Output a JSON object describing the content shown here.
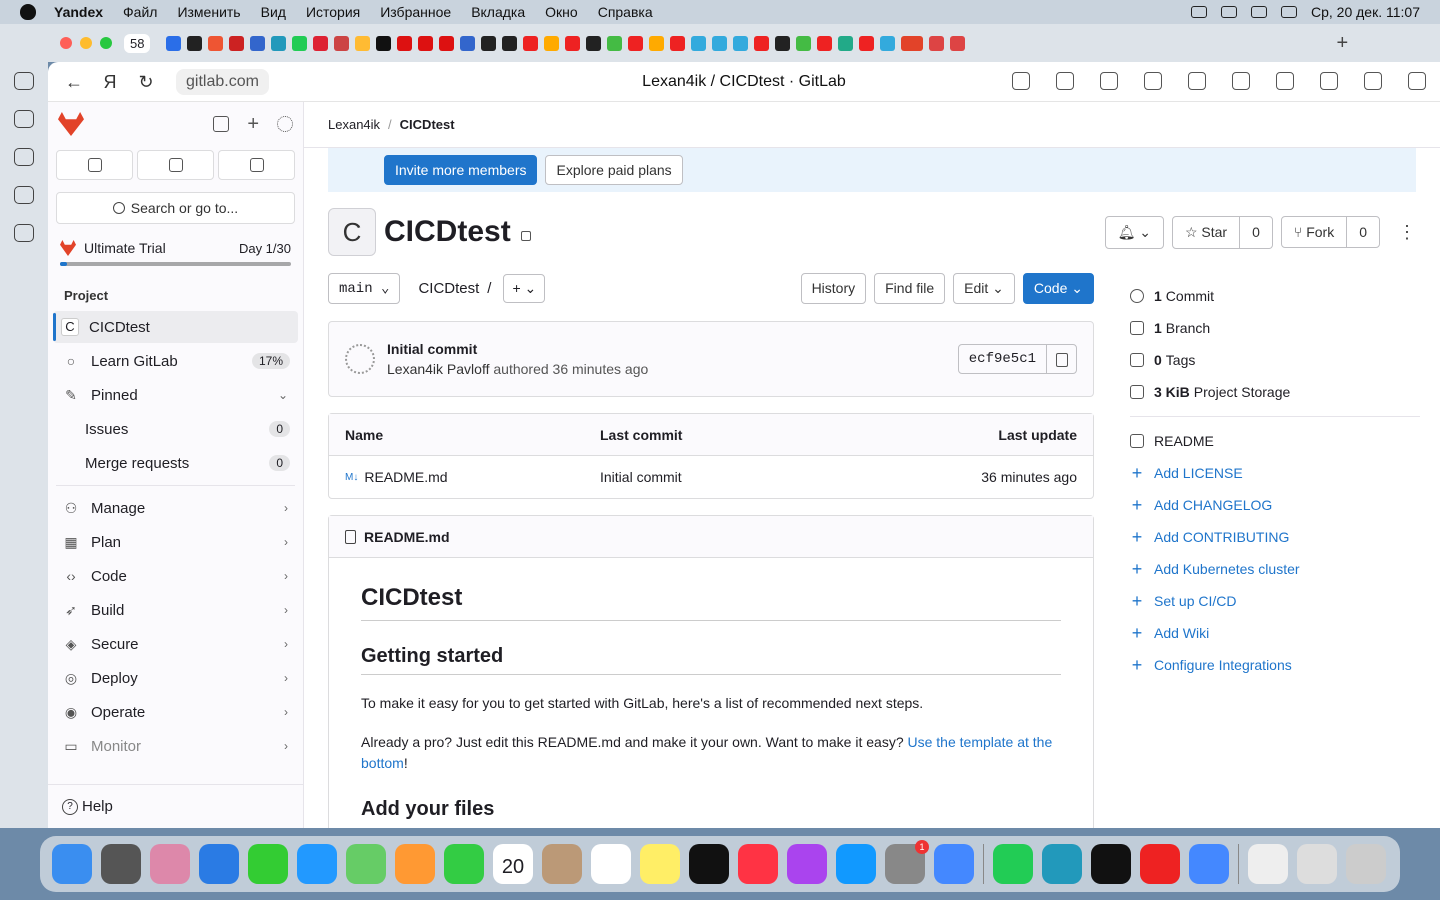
{
  "menubar": {
    "app": "Yandex",
    "items": [
      "Файл",
      "Изменить",
      "Вид",
      "История",
      "Избранное",
      "Вкладка",
      "Окно",
      "Справка"
    ],
    "clock": "Ср, 20 дек.  11:07"
  },
  "tabs": {
    "count": "58"
  },
  "address": {
    "url": "gitlab.com",
    "title": "Lexan4ik / CICDtest · GitLab"
  },
  "sidebar": {
    "search_label": "Search or go to...",
    "trial": {
      "label": "Ultimate Trial",
      "day": "Day 1/30",
      "progress": 0.03
    },
    "section": "Project",
    "items": [
      {
        "label": "CICDtest",
        "icon": "project-avatar",
        "active": true
      },
      {
        "label": "Learn GitLab",
        "icon": "bulb-icon",
        "badge": "17%"
      },
      {
        "label": "Pinned",
        "icon": "pin-icon",
        "expand": true
      }
    ],
    "pinned": [
      {
        "label": "Issues",
        "count": "0"
      },
      {
        "label": "Merge requests",
        "count": "0"
      }
    ],
    "groups": [
      {
        "label": "Manage",
        "icon": "users-icon"
      },
      {
        "label": "Plan",
        "icon": "calendar-icon"
      },
      {
        "label": "Code",
        "icon": "code-icon"
      },
      {
        "label": "Build",
        "icon": "rocket-icon"
      },
      {
        "label": "Secure",
        "icon": "shield-icon"
      },
      {
        "label": "Deploy",
        "icon": "deploy-icon"
      },
      {
        "label": "Operate",
        "icon": "operate-icon"
      },
      {
        "label": "Monitor",
        "icon": "monitor-icon"
      }
    ],
    "help": "Help"
  },
  "breadcrumb": {
    "owner": "Lexan4ik",
    "project": "CICDtest"
  },
  "banner": {
    "invite": "Invite more members",
    "explore": "Explore paid plans"
  },
  "project": {
    "initial": "C",
    "name": "CICDtest",
    "star": "Star",
    "star_count": "0",
    "fork": "Fork",
    "fork_count": "0"
  },
  "tree": {
    "branch": "main",
    "path": "CICDtest",
    "history": "History",
    "find": "Find file",
    "edit": "Edit",
    "code": "Code"
  },
  "commit": {
    "title": "Initial commit",
    "author": "Lexan4ik Pavloff",
    "meta": "authored 36 minutes ago",
    "sha": "ecf9e5c1"
  },
  "files": {
    "headers": [
      "Name",
      "Last commit",
      "Last update"
    ],
    "rows": [
      {
        "name": "README.md",
        "commit": "Initial commit",
        "updated": "36 minutes ago"
      }
    ]
  },
  "readme": {
    "file": "README.md",
    "h1": "CICDtest",
    "h2": "Getting started",
    "p1": "To make it easy for you to get started with GitLab, here's a list of recommended next steps.",
    "p2": "Already a pro? Just edit this README.md and make it your own. Want to make it easy? ",
    "p2_link": "Use the template at the bottom",
    "p2_end": "!",
    "h2b": "Add your files"
  },
  "stats": [
    {
      "num": "1",
      "label": "Commit"
    },
    {
      "num": "1",
      "label": "Branch"
    },
    {
      "num": "0",
      "label": "Tags"
    },
    {
      "num": "3 KiB",
      "label": "Project Storage"
    }
  ],
  "links": {
    "readme": "README",
    "add": [
      "Add LICENSE",
      "Add CHANGELOG",
      "Add CONTRIBUTING",
      "Add Kubernetes cluster",
      "Set up CI/CD",
      "Add Wiki",
      "Configure Integrations"
    ]
  },
  "dock": {
    "calendar_day": "20",
    "settings_badge": "1"
  }
}
